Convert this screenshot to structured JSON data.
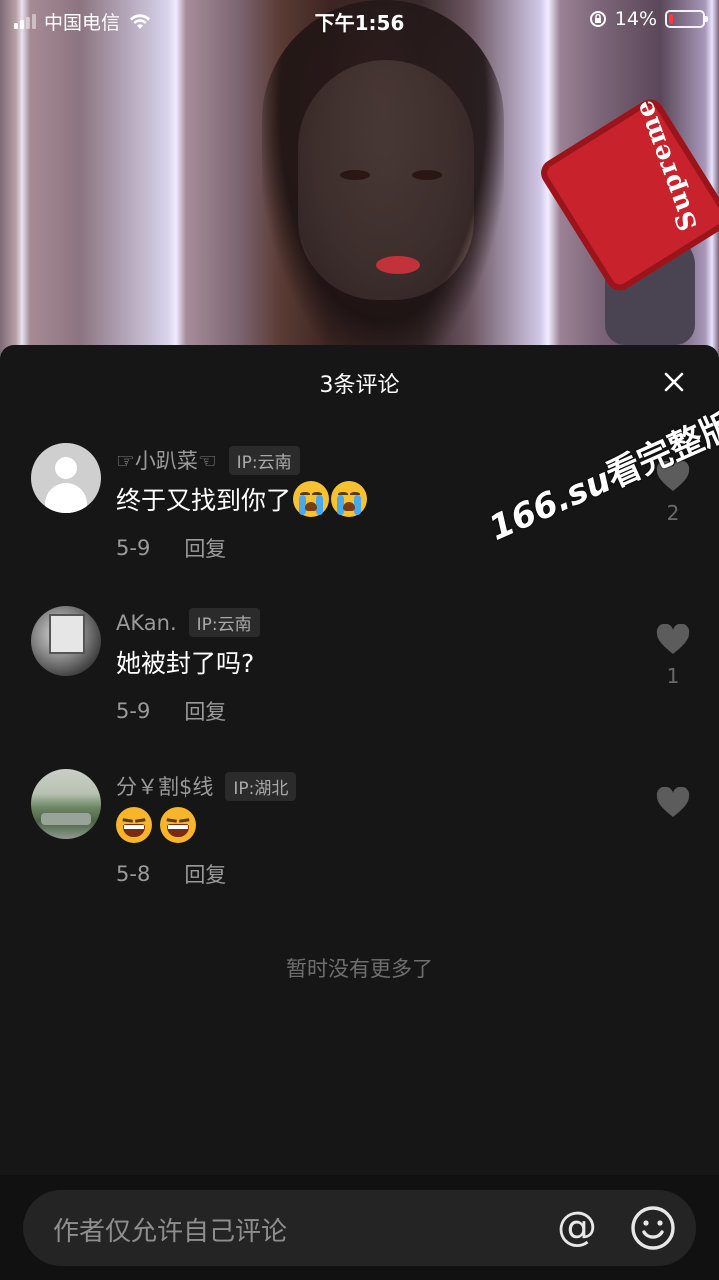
{
  "status_bar": {
    "carrier": "中国电信",
    "time": "下午1:56",
    "battery_percent": "14%",
    "battery_level": 0.14,
    "battery_color": "#ff3b30"
  },
  "video": {
    "prop_text": "Supreme"
  },
  "comments_panel": {
    "title": "3条评论",
    "close_icon": "close-icon",
    "comments": [
      {
        "username": "☞小趴菜☜",
        "ip": "IP:云南",
        "text": "终于又找到你了",
        "emojis": [
          "crying-face",
          "crying-face"
        ],
        "date": "5-9",
        "reply_label": "回复",
        "like_count": "2"
      },
      {
        "username": "AKan.",
        "ip": "IP:云南",
        "text": "她被封了吗?",
        "emojis": [],
        "date": "5-9",
        "reply_label": "回复",
        "like_count": "1"
      },
      {
        "username": "分￥割$线",
        "ip": "IP:湖北",
        "text": "",
        "emojis": [
          "laughing-face",
          "laughing-face"
        ],
        "date": "5-8",
        "reply_label": "回复",
        "like_count": ""
      }
    ],
    "end_note": "暂时没有更多了"
  },
  "watermark": {
    "domain": "166.su",
    "text": "看完整版"
  },
  "input_bar": {
    "placeholder": "作者仅允许自己评论",
    "at_symbol": "@",
    "emoji_icon": "smiley-icon"
  }
}
